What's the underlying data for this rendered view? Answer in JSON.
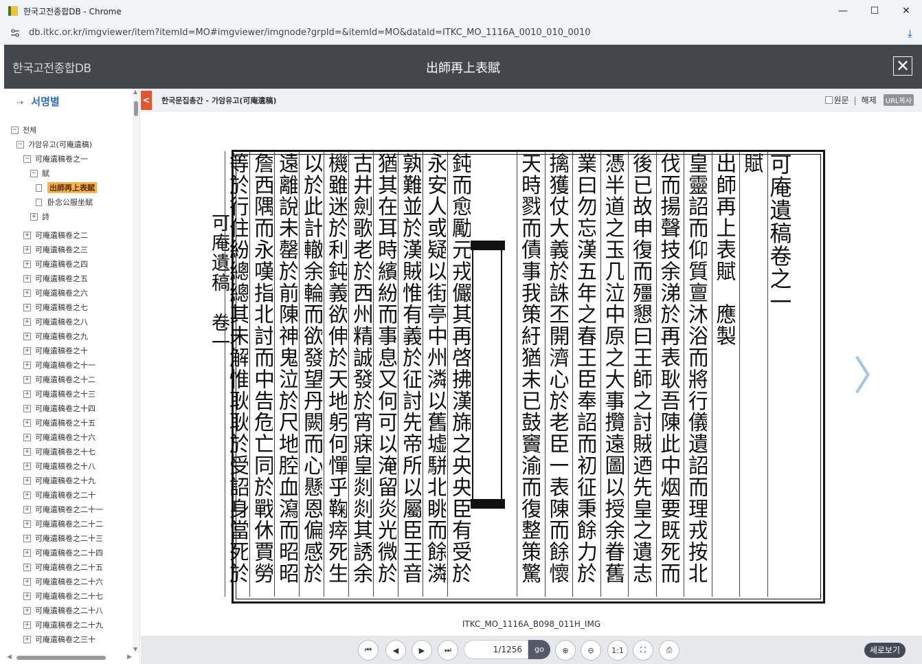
{
  "browser": {
    "tab_title": "한국고전종합DB - Chrome",
    "url": "db.itkc.or.kr/imgviewer/item?itemId=MO#imgviewer/imgnode?grpId=&itemId=MO&dataId=ITKC_MO_1116A_0010_010_0010",
    "minimize": "—",
    "maximize": "☐",
    "close": "✕",
    "download_icon": "⤓"
  },
  "header": {
    "logo": "한국고전종합DB",
    "title": "出師再上表賦",
    "close": "✕"
  },
  "sidebar": {
    "heading": "서명별",
    "heading_icon": "⇢",
    "tree": [
      {
        "label": "전체",
        "toggle": "−",
        "level": 0
      },
      {
        "label": "가암유고(可庵遺稿)",
        "toggle": "−",
        "level": 1
      },
      {
        "label": "可庵遺稿卷之一",
        "toggle": "−",
        "level": 2
      },
      {
        "label": "賦",
        "toggle": "−",
        "level": 3
      },
      {
        "label": "出師再上表賦",
        "toggle": "doc",
        "level": 4,
        "selected": true
      },
      {
        "label": "卧念公服坐賦",
        "toggle": "doc",
        "level": 4
      },
      {
        "label": "詩",
        "toggle": "+",
        "level": 3
      },
      {
        "label": "可庵遺稿卷之二",
        "toggle": "+",
        "level": 2
      },
      {
        "label": "可庵遺稿卷之三",
        "toggle": "+",
        "level": 2
      },
      {
        "label": "可庵遺稿卷之四",
        "toggle": "+",
        "level": 2
      },
      {
        "label": "可庵遺稿卷之五",
        "toggle": "+",
        "level": 2
      },
      {
        "label": "可庵遺稿卷之六",
        "toggle": "+",
        "level": 2
      },
      {
        "label": "可庵遺稿卷之七",
        "toggle": "+",
        "level": 2
      },
      {
        "label": "可庵遺稿卷之八",
        "toggle": "+",
        "level": 2
      },
      {
        "label": "可庵遺稿卷之九",
        "toggle": "+",
        "level": 2
      },
      {
        "label": "可庵遺稿卷之十",
        "toggle": "+",
        "level": 2
      },
      {
        "label": "可庵遺稿卷之十一",
        "toggle": "+",
        "level": 2
      },
      {
        "label": "可庵遺稿卷之十二",
        "toggle": "+",
        "level": 2
      },
      {
        "label": "可庵遺稿卷之十三",
        "toggle": "+",
        "level": 2
      },
      {
        "label": "可庵遺稿卷之十四",
        "toggle": "+",
        "level": 2
      },
      {
        "label": "可庵遺稿卷之十五",
        "toggle": "+",
        "level": 2
      },
      {
        "label": "可庵遺稿卷之十六",
        "toggle": "+",
        "level": 2
      },
      {
        "label": "可庵遺稿卷之十七",
        "toggle": "+",
        "level": 2
      },
      {
        "label": "可庵遺稿卷之十八",
        "toggle": "+",
        "level": 2
      },
      {
        "label": "可庵遺稿卷之十九",
        "toggle": "+",
        "level": 2
      },
      {
        "label": "可庵遺稿卷之二十",
        "toggle": "+",
        "level": 2
      },
      {
        "label": "可庵遺稿卷之二十一",
        "toggle": "+",
        "level": 2
      },
      {
        "label": "可庵遺稿卷之二十二",
        "toggle": "+",
        "level": 2
      },
      {
        "label": "可庵遺稿卷之二十三",
        "toggle": "+",
        "level": 2
      },
      {
        "label": "可庵遺稿卷之二十四",
        "toggle": "+",
        "level": 2
      },
      {
        "label": "可庵遺稿卷之二十五",
        "toggle": "+",
        "level": 2
      },
      {
        "label": "可庵遺稿卷之二十六",
        "toggle": "+",
        "level": 2
      },
      {
        "label": "可庵遺稿卷之二十七",
        "toggle": "+",
        "level": 2
      },
      {
        "label": "可庵遺稿卷之二十八",
        "toggle": "+",
        "level": 2
      },
      {
        "label": "可庵遺稿卷之二十九",
        "toggle": "+",
        "level": 2
      },
      {
        "label": "可庵遺稿卷之三十",
        "toggle": "+",
        "level": 2
      }
    ]
  },
  "content_head": {
    "back_icon": "<",
    "breadcrumb": "한국문집총간 - 가암유고(可庵遺稿)",
    "original_label": "원문",
    "separator": "|",
    "commentary_label": "해제",
    "url_copy": "URL복사"
  },
  "viewer": {
    "prev_icon": "〈",
    "next_icon": "〉",
    "image_name": "ITKC_MO_1116A_B098_011H_IMG",
    "scan": {
      "margin_label": "可庵遺稿　卷一",
      "columns_right": [
        "可庵遺稿卷之一",
        "賦",
        "出師再上表賦　應製",
        "皇靈詔而仰質亶沐浴而將行儀遺詔而理戎按北",
        "伐而揚聲技余涕於再表耿吾陳此中烟要既死而",
        "後已故申復而殭懇曰王師之討賊迺先皇之遺志",
        "憑半道之玉几泣中原之大事攬遠圖以授余眷舊",
        "業曰勿忘漢五年之春王臣奉詔而初征秉餘力於",
        "擒獲仗大義於誅丕開濟心於老臣一表陳而餘懷",
        "天時戮而債事我策紆猶未已鼓竇渝而復整策驚"
      ],
      "columns_left": [
        "鈍而愈勵元戎儼其再啓拂漢旆之央央臣有受於",
        "永安人或疑以街亭中州潾以舊墟駢北眺而餘潾",
        "孰難並於漢賊惟有義於征討先帝所以屬臣王音",
        "猶其在耳時繽紛而事息又何可以淹留炎光微於",
        "古井劍歌老於西州精誠發於宵寐皇剡剡其誘余",
        "機雖迷於利鈍義欲伸於天地躬何憚乎鞠瘁死生",
        "以於此計轍余輪而欲發望丹闕而心懸恩偏感於",
        "遠離說未罄於前陳神鬼泣於尺地腔血瀉而昭昭",
        "詹西隅而永嘆指北討而中告危亡同於戰休賈勞",
        "等於行住紛總總其未解惟耿耿於受詔身當死於"
      ]
    }
  },
  "controls": {
    "first_icon": "⏮",
    "prev_icon": "◀",
    "next_icon": "▶",
    "last_icon": "⏭",
    "page": "1/1256",
    "go": "go",
    "zoom_in_icon": "⊕",
    "zoom_out_icon": "⊖",
    "actual_size": "1:1",
    "fit_icon": "⛶",
    "print_icon": "⎙",
    "vertical_view": "세로보기"
  }
}
